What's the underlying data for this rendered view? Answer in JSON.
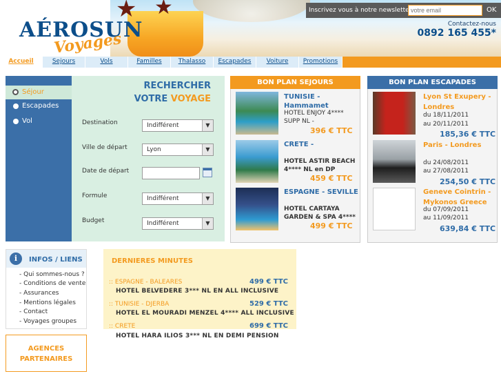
{
  "header": {
    "logo_top": "AÉROSUN",
    "logo_bottom": "Voyages",
    "newsletter_label": "Inscrivez vous à notre newsletter :",
    "newsletter_placeholder": "votre email",
    "newsletter_ok": "OK",
    "contact_label": "Contactez-nous",
    "phone": "0892 165 455*"
  },
  "nav": [
    "Accueil",
    "Sejours",
    "Vols",
    "Familles",
    "Thalasso",
    "Escapades",
    "Voiture",
    "Promotions"
  ],
  "search": {
    "tabs": [
      "Séjour",
      "Escapades",
      "Vol"
    ],
    "title_line1": "RECHERCHER",
    "title_line2a": "VOTRE ",
    "title_line2b": "VOYAGE",
    "fields": {
      "destination_label": "Destination",
      "destination_value": "Indifférent",
      "ville_label": "Ville de départ",
      "ville_value": "Lyon",
      "date_label": "Date de départ",
      "formule_label": "Formule",
      "formule_value": "Indifférent",
      "budget_label": "Budget",
      "budget_value": "Indifférent"
    }
  },
  "bon_plan_sejours": {
    "title": "BON PLAN SEJOURS",
    "items": [
      {
        "dest1": "TUNISIE -",
        "dest2": "Hammamet",
        "hotel": "HOTEL ENJOY 4****",
        "extra": "SUPP NL -",
        "price": "396 € TTC"
      },
      {
        "dest1": "CRETE -",
        "hotel": "HOTEL ASTIR BEACH",
        "extra": "4**** NL en DP",
        "price": "459 € TTC"
      },
      {
        "dest1": "ESPAGNE - SEVILLE",
        "hotel": "HOTEL CARTAYA",
        "extra": "GARDEN & SPA 4****",
        "price": "499 € TTC"
      }
    ]
  },
  "bon_plan_escapades": {
    "title": "BON PLAN ESCAPADES",
    "items": [
      {
        "dest1": "Lyon St Exupery -",
        "dest2": "Londres",
        "from": "du 18/11/2011",
        "to": "au 20/11/2011",
        "price": "185,36 € TTC"
      },
      {
        "dest1": "Paris - Londres",
        "from": "du 24/08/2011",
        "to": "au 27/08/2011",
        "price": "254,50 € TTC"
      },
      {
        "dest1": "Geneve Cointrin -",
        "dest2": "Mykonos Greece",
        "from": "du 07/09/2011",
        "to": "au 11/09/2011",
        "price": "639,84 € TTC"
      }
    ]
  },
  "infos": {
    "title": "INFOS / LIENS",
    "links": [
      "- Qui sommes-nous ?",
      "- Conditions de vente",
      "- Assurances",
      "- Mentions légales",
      "- Contact",
      "- Voyages groupes"
    ]
  },
  "agences": {
    "line1": "AGENCES",
    "line2": "PARTENAIRES"
  },
  "dernieres_minutes": {
    "title": "DERNIERES MINUTES",
    "items": [
      {
        "dest": ":: ESPAGNE - BALEARES",
        "price": "499 € TTC",
        "hotel": "HOTEL BELVEDERE 3*** NL EN ALL INCLUSIVE"
      },
      {
        "dest": ":: TUNISIE - DJERBA",
        "price": "529 € TTC",
        "hotel": "HOTEL EL MOURADI MENZEL 4**** ALL INCLUSIVE"
      },
      {
        "dest": ":: CRETE",
        "price": "699 € TTC",
        "hotel": "HOTEL HARA ILIOS 3*** NL EN DEMI PENSION"
      }
    ]
  },
  "colors": {
    "brand_blue": "#2f6ca7",
    "accent_orange": "#f39a1f",
    "price_blue": "#2f6ca7"
  }
}
